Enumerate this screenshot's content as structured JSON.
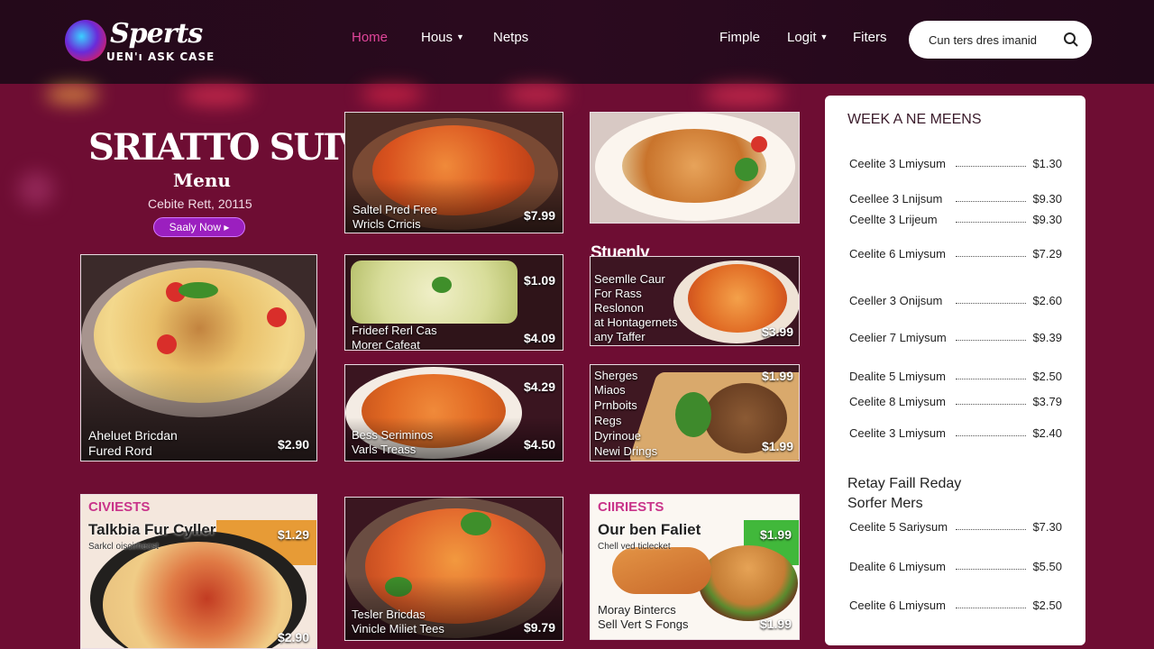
{
  "brand": {
    "name": "Sperts",
    "tagline": "UEN'ı ASK CASE"
  },
  "nav": {
    "items": [
      {
        "label": "Home",
        "active": true
      },
      {
        "label": "Hous",
        "dropdown": true
      },
      {
        "label": "Netps"
      },
      {
        "label": "Fimple"
      },
      {
        "label": "Logit",
        "dropdown": true
      },
      {
        "label": "Fiters"
      }
    ]
  },
  "search": {
    "value": "Cun ters dres imanid",
    "icon": "search-icon"
  },
  "hero": {
    "title": "SRIATTO SUIVITE",
    "subtitle": "Menu",
    "date": "Cebite Rett, 20115",
    "button": "Saaly Now ▸"
  },
  "cards": {
    "top_middle": {
      "label_1": "Saltel Pred Free",
      "label_2": "Wricls Crricis",
      "price": "$7.99"
    },
    "main_pasta": {
      "label_1": "Aheluet Bricdan",
      "label_2": "Fured Rord",
      "price": "$2.90"
    },
    "slaw": {
      "label_1": "Frideef Rerl Cas",
      "label_2": "Morer Cafeat",
      "price_top": "$1.09",
      "price": "$4.09"
    },
    "fries_center": {
      "label_1": "Bess Seriminos",
      "label_2": "Varls Treass",
      "price_top": "$4.29",
      "price": "$4.50"
    },
    "section_title": "Stuenly",
    "chili_fries": {
      "lines": [
        "Seemlle Caur",
        "For Rass",
        "Reslonon",
        "at Hontagernets",
        "any Taffer"
      ],
      "price": "$3.99"
    },
    "board": {
      "lines": [
        "Sherges",
        "Miaos",
        "Prnboits",
        "Regs",
        "Dyrinoue",
        "Newi Drings"
      ],
      "price_top": "$1.99",
      "price": "$1.99"
    },
    "bottom_left": {
      "tag": "CIVIESTS",
      "title": "Talkbia Fur Cyller",
      "small": "Sarkcl oiscirhecst",
      "price_top": "$1.29",
      "price": "$2.90"
    },
    "bottom_middle": {
      "label_1": "Tesler Bricdas",
      "label_2": "Vinicle Miliet Tees",
      "price": "$9.79"
    },
    "bottom_right": {
      "tag": "CIIRIESTS",
      "title": "Our ben Faliet",
      "small": "Chell ved ticlecket",
      "label_1": "Moray Bintercs",
      "label_2": "Sell Vert S Fongs",
      "price_top": "$1.99",
      "price": "$1.99"
    }
  },
  "specials": {
    "title": "WEEK A NE MEENS",
    "rows": [
      {
        "name": "Ceelite 3 Lmiysum",
        "price": "$1.30"
      },
      {
        "name": "Ceellee 3 Lnijsum",
        "price": "$9.30"
      },
      {
        "name": "Ceellte 3 Lrijeum",
        "price": "$9.30"
      },
      {
        "name": "Ceelite 6 Lmiysum",
        "price": "$7.29"
      },
      {
        "name": "Ceeller 3 Onijsum",
        "price": "$2.60"
      },
      {
        "name": "Ceelier 7 Lmiysum",
        "price": "$9.39"
      },
      {
        "name": "Dealite 5 Lmiysum",
        "price": "$2.50"
      },
      {
        "name": "Ceelite 8 Lmiysum",
        "price": "$3.79"
      },
      {
        "name": "Ceelite 3 Lmiysum",
        "price": "$2.40"
      }
    ],
    "sub_title_1": "Retay Faill Reday",
    "sub_title_2": "Sorfer Mers",
    "sub_rows": [
      {
        "name": "Ceelite 5 Sariysum",
        "price": "$7.30"
      },
      {
        "name": "Dealite 6 Lmiysum",
        "price": "$5.50"
      },
      {
        "name": "Ceelite 6 Lmiysum",
        "price": "$2.50"
      }
    ]
  },
  "colors": {
    "accent": "#e0459a",
    "background": "#6e0d33",
    "header": "#24091a",
    "button": "#9b1fbf"
  }
}
